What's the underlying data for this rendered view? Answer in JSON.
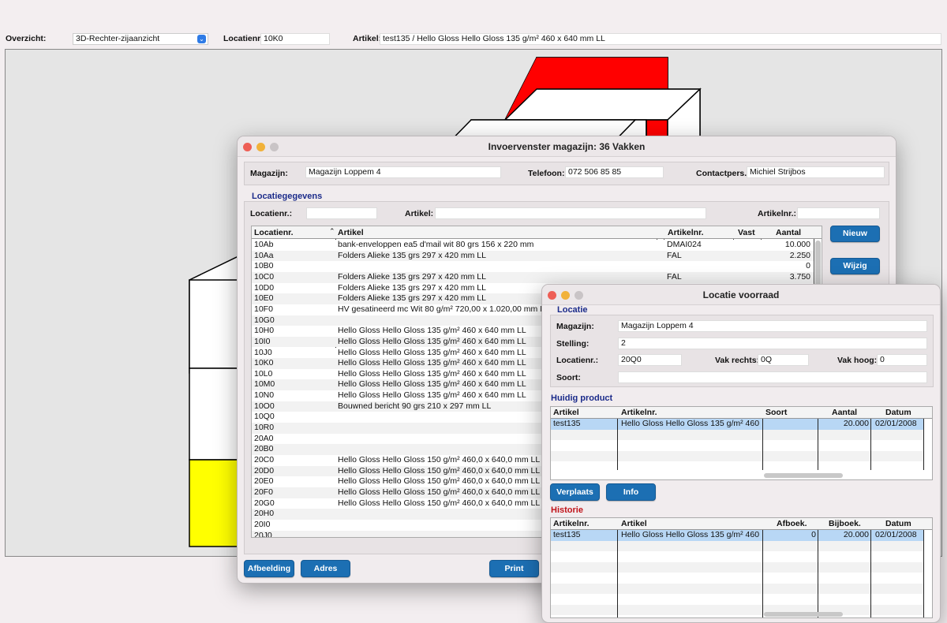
{
  "topbar": {
    "overzicht_label": "Overzicht:",
    "overzicht_value": "3D-Rechter-zijaanzicht",
    "locatienr_label": "Locatienr.:",
    "locatienr_value": "10K0",
    "artikel_label": "Artikel:",
    "artikel_value": "test135 / Hello Gloss Hello Gloss 135 g/m² 460 x 640 mm LL"
  },
  "colors": {
    "red": "#ff0000",
    "yellow": "#ffff00",
    "button": "#1c6fb3",
    "selection": "#b8d7f5"
  },
  "invoer": {
    "title": "Invoervenster magazijn: 36 Vakken",
    "magazijn_label": "Magazijn:",
    "magazijn_value": "Magazijn Loppem 4",
    "telefoon_label": "Telefoon:",
    "telefoon_value": "072 506 85 85",
    "contact_label": "Contactpers.:",
    "contact_value": "Michiel Strijbos",
    "section_title": "Locatiegegevens",
    "f_locatienr_label": "Locatienr.:",
    "f_artikel_label": "Artikel:",
    "f_artikelnr_label": "Artikelnr.:",
    "columns": [
      "Locatienr.",
      "Artikel",
      "Artikelnr.",
      "Vast",
      "Aantal"
    ],
    "rows": [
      [
        "10Ab",
        "bank-enveloppen ea5 d'mail wit 80 grs 156 x 220 mm",
        "DMAI024",
        "",
        "10.000"
      ],
      [
        "10Aa",
        "Folders Alieke 135 grs 297 x 420 mm LL",
        "FAL",
        "",
        "2.250"
      ],
      [
        "10B0",
        "",
        "",
        "",
        "0"
      ],
      [
        "10C0",
        "Folders Alieke 135 grs 297 x 420 mm LL",
        "FAL",
        "",
        "3.750"
      ],
      [
        "10D0",
        "Folders Alieke 135 grs 297 x 420 mm LL",
        "",
        "",
        ""
      ],
      [
        "10E0",
        "Folders Alieke 135 grs 297 x 420 mm LL",
        "",
        "",
        ""
      ],
      [
        "10F0",
        "HV gesatineerd mc Wit 80 g/m² 720,00 x 1.020,00 mm LL",
        "",
        "",
        ""
      ],
      [
        "10G0",
        "",
        "",
        "",
        ""
      ],
      [
        "10H0",
        "Hello Gloss Hello Gloss 135 g/m² 460 x 640 mm LL",
        "",
        "",
        ""
      ],
      [
        "10I0",
        "Hello Gloss Hello Gloss 135 g/m² 460 x 640 mm LL",
        "",
        "",
        ""
      ],
      [
        "10J0",
        "Hello Gloss Hello Gloss 135 g/m² 460 x 640 mm LL",
        "",
        "",
        ""
      ],
      [
        "10K0",
        "Hello Gloss Hello Gloss 135 g/m² 460 x 640 mm LL",
        "",
        "",
        ""
      ],
      [
        "10L0",
        "Hello Gloss Hello Gloss 135 g/m² 460 x 640 mm LL",
        "",
        "",
        ""
      ],
      [
        "10M0",
        "Hello Gloss Hello Gloss 135 g/m² 460 x 640 mm LL",
        "",
        "",
        ""
      ],
      [
        "10N0",
        "Hello Gloss Hello Gloss 135 g/m² 460 x 640 mm LL",
        "",
        "",
        ""
      ],
      [
        "10O0",
        "Bouwned bericht 90 grs 210 x 297 mm LL",
        "",
        "",
        ""
      ],
      [
        "10Q0",
        "",
        "",
        "",
        ""
      ],
      [
        "10R0",
        "",
        "",
        "",
        ""
      ],
      [
        "20A0",
        "",
        "",
        "",
        ""
      ],
      [
        "20B0",
        "",
        "",
        "",
        ""
      ],
      [
        "20C0",
        "Hello Gloss Hello Gloss 150 g/m² 460,0 x 640,0 mm LL",
        "",
        "",
        ""
      ],
      [
        "20D0",
        "Hello Gloss Hello Gloss 150 g/m² 460,0 x 640,0 mm LL",
        "",
        "",
        ""
      ],
      [
        "20E0",
        "Hello Gloss Hello Gloss 150 g/m² 460,0 x 640,0 mm LL",
        "",
        "",
        ""
      ],
      [
        "20F0",
        "Hello Gloss Hello Gloss 150 g/m² 460,0 x 640,0 mm LL",
        "",
        "",
        ""
      ],
      [
        "20G0",
        "Hello Gloss Hello Gloss 150 g/m² 460,0 x 640,0 mm LL",
        "",
        "",
        ""
      ],
      [
        "20H0",
        "",
        "",
        "",
        ""
      ],
      [
        "20I0",
        "",
        "",
        "",
        ""
      ],
      [
        "20J0",
        "",
        "",
        "",
        ""
      ]
    ],
    "btn_nieuw": "Nieuw",
    "btn_wijzig": "Wijzig",
    "btn_afbeelding": "Afbeelding",
    "btn_adres": "Adres",
    "btn_print": "Print"
  },
  "locatie": {
    "title": "Locatie voorraad",
    "section_locatie": "Locatie",
    "magazijn_label": "Magazijn:",
    "magazijn_value": "Magazijn Loppem 4",
    "stelling_label": "Stelling:",
    "stelling_value": "2",
    "locatienr_label": "Locatienr.:",
    "locatienr_value": "20Q0",
    "vakrechts_label": "Vak rechts:",
    "vakrechts_value": "0Q",
    "vakhoog_label": "Vak hoog:",
    "vakhoog_value": "0",
    "soort_label": "Soort:",
    "soort_value": "",
    "section_product": "Huidig product",
    "product_columns": [
      "Artikel",
      "Artikelnr.",
      "Soort",
      "Aantal",
      "Datum"
    ],
    "product_rows": [
      [
        "test135",
        "Hello Gloss Hello Gloss 135 g/m² 460 x 640 mm LL",
        "",
        "20.000",
        "02/01/2008"
      ]
    ],
    "btn_verplaats": "Verplaats",
    "btn_info": "Info",
    "section_historie": "Historie",
    "historie_columns": [
      "Artikelnr.",
      "Artikel",
      "Afboek.",
      "Bijboek.",
      "Datum"
    ],
    "historie_rows": [
      [
        "test135",
        "Hello Gloss Hello Gloss 135 g/m² 460 x 640 mm LL",
        "0",
        "20.000",
        "02/01/2008"
      ]
    ]
  }
}
